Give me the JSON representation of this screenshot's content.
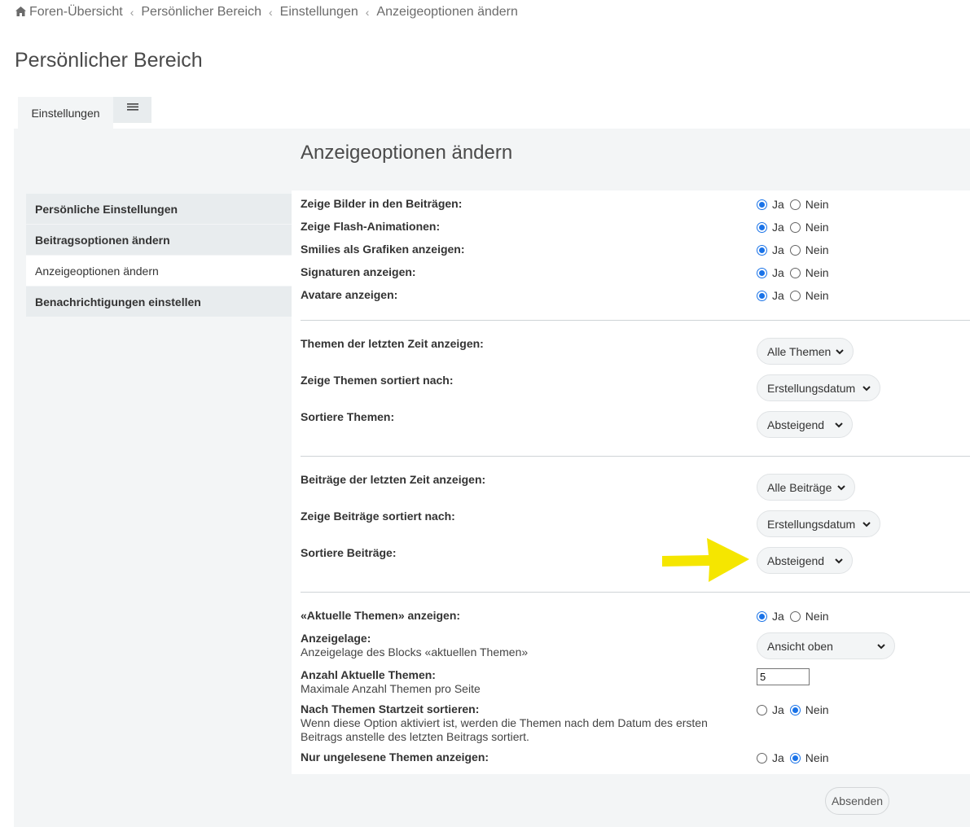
{
  "breadcrumb": {
    "items": [
      "Foren-Übersicht",
      "Persönlicher Bereich",
      "Einstellungen",
      "Anzeigeoptionen ändern"
    ],
    "separator": "‹"
  },
  "page_title": "Persönlicher Bereich",
  "tabs": {
    "active_label": "Einstellungen",
    "menu_icon": "hamburger-icon"
  },
  "section_title": "Anzeigeoptionen ändern",
  "sidebar": {
    "items": [
      {
        "label": "Persönliche Einstellungen",
        "active": false
      },
      {
        "label": "Beitragsoptionen ändern",
        "active": false
      },
      {
        "label": "Anzeigeoptionen ändern",
        "active": true
      },
      {
        "label": "Benachrichtigungen einstellen",
        "active": false
      }
    ]
  },
  "radio_labels": {
    "yes": "Ja",
    "no": "Nein"
  },
  "display_options": [
    {
      "label": "Zeige Bilder in den Beiträgen:",
      "value": "Ja"
    },
    {
      "label": "Zeige Flash-Animationen:",
      "value": "Ja"
    },
    {
      "label": "Smilies als Grafiken anzeigen:",
      "value": "Ja"
    },
    {
      "label": "Signaturen anzeigen:",
      "value": "Ja"
    },
    {
      "label": "Avatare anzeigen:",
      "value": "Ja"
    }
  ],
  "topic_options": [
    {
      "label": "Themen der letzten Zeit anzeigen:",
      "value": "Alle Themen"
    },
    {
      "label": "Zeige Themen sortiert nach:",
      "value": "Erstellungsdatum"
    },
    {
      "label": "Sortiere Themen:",
      "value": "Absteigend"
    }
  ],
  "post_options": [
    {
      "label": "Beiträge der letzten Zeit anzeigen:",
      "value": "Alle Beiträge"
    },
    {
      "label": "Zeige Beiträge sortiert nach:",
      "value": "Erstellungsdatum"
    },
    {
      "label": "Sortiere Beiträge:",
      "value": "Absteigend"
    }
  ],
  "recent_topics": {
    "show_label": "«Aktuelle Themen» anzeigen:",
    "show_value": "Ja",
    "location_label": "Anzeigelage:",
    "location_desc": "Anzeigelage des Blocks «aktuellen Themen»",
    "location_value": "Ansicht oben",
    "count_label": "Anzahl Aktuelle Themen:",
    "count_desc": "Maximale Anzahl Themen pro Seite",
    "count_value": "5",
    "sort_start_label": "Nach Themen Startzeit sortieren:",
    "sort_start_desc_line1": "Wenn diese Option aktiviert ist, werden die Themen nach dem Datum des ersten",
    "sort_start_desc_line2": "Beitrags anstelle des letzten Beitrags sortiert.",
    "sort_start_value": "Nein",
    "unread_label": "Nur ungelesene Themen anzeigen:",
    "unread_value": "Nein"
  },
  "submit_label": "Absenden",
  "colors": {
    "radio_accent": "#1a73e8",
    "annotation_arrow": "#f5e600",
    "panel_bg": "#f3f5f6"
  }
}
